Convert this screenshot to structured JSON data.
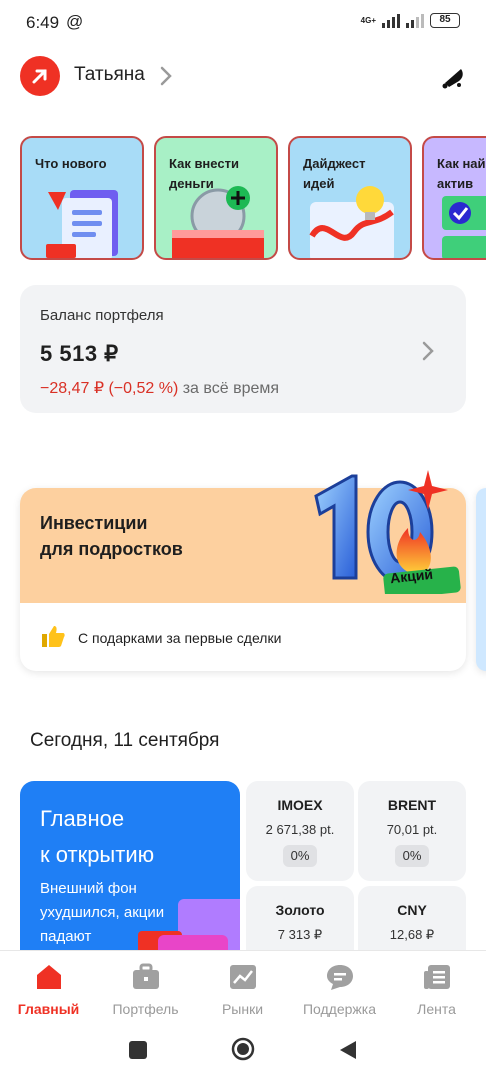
{
  "status_bar": {
    "time": "6:49",
    "at_symbol": "@",
    "network": "4G+",
    "battery": "85"
  },
  "header": {
    "user_name": "Татьяна"
  },
  "stories": [
    {
      "label": "Что нового"
    },
    {
      "label": "Как внести\nденьги"
    },
    {
      "label": "Дайджест\nидей"
    },
    {
      "label": "Как най\nактив"
    }
  ],
  "balance": {
    "label": "Баланс портфеля",
    "value": "5 513 ₽",
    "change": "−28,47 ₽ (−0,52 %)",
    "period": "за всё время"
  },
  "promo": {
    "title": "Инвестиции\nдля подростков",
    "badge_number": "10",
    "badge_label": "Акций",
    "footer_text": "С подарками за первые сделки"
  },
  "date_heading": "Сегодня, 11 сентября",
  "news": {
    "title": "Главное\nк открытию",
    "subtitle": "Внешний фон\nухудшился, акции\nпадают"
  },
  "tiles": [
    {
      "name": "IMOEX",
      "value": "2 671,38 pt.",
      "change": "0%"
    },
    {
      "name": "BRENT",
      "value": "70,01 pt.",
      "change": "0%"
    },
    {
      "name": "Золото",
      "value": "7 313 ₽",
      "change": ""
    },
    {
      "name": "CNY",
      "value": "12,68 ₽",
      "change": ""
    }
  ],
  "tab_bar": [
    {
      "label": "Главный",
      "icon": "home-icon",
      "active": true
    },
    {
      "label": "Портфель",
      "icon": "briefcase-icon",
      "active": false
    },
    {
      "label": "Рынки",
      "icon": "chart-icon",
      "active": false
    },
    {
      "label": "Поддержка",
      "icon": "chat-icon",
      "active": false
    },
    {
      "label": "Лента",
      "icon": "feed-icon",
      "active": false
    }
  ],
  "colors": {
    "brand": "#ef3124",
    "news_card": "#1f7ff5",
    "promo": "#fdd09f",
    "negative": "#d93025"
  }
}
